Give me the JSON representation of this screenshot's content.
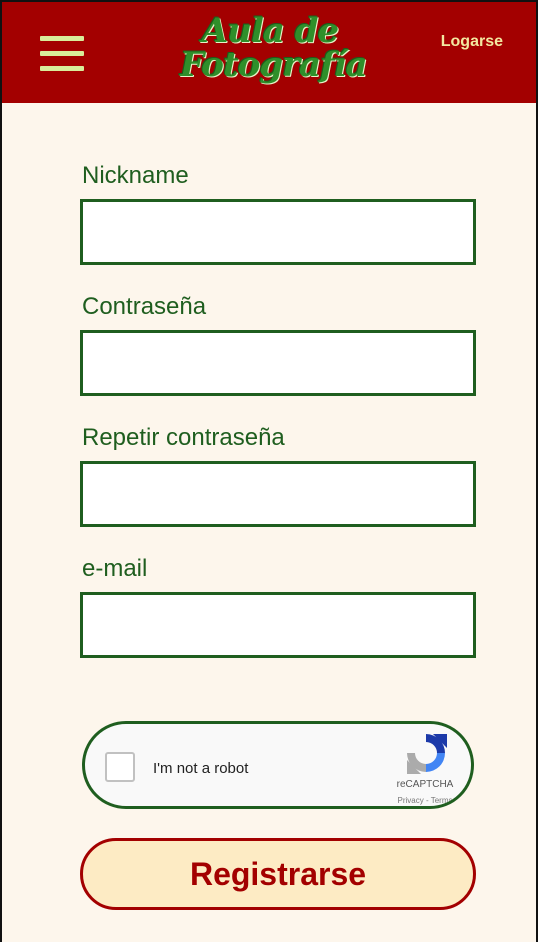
{
  "header": {
    "logo_line1": "Aula de",
    "logo_line2": "Fotografía",
    "login_label": "Logarse"
  },
  "form": {
    "fields": [
      {
        "label": "Nickname",
        "value": "",
        "placeholder": ""
      },
      {
        "label": "Contraseña",
        "value": "",
        "placeholder": ""
      },
      {
        "label": "Repetir contraseña",
        "value": "",
        "placeholder": ""
      },
      {
        "label": "e-mail",
        "value": "",
        "placeholder": ""
      }
    ],
    "captcha": {
      "label": "I'm not a robot",
      "brand": "reCAPTCHA",
      "links": "Privacy - Terms",
      "checked": false
    },
    "submit_label": "Registrarse"
  },
  "colors": {
    "header_bg": "#a30000",
    "page_bg": "#fdf6ec",
    "field_border": "#1f5e1f",
    "button_bg": "#fdebc4",
    "button_text": "#a30000",
    "login_text": "#f3e7a0",
    "menu_icon": "#d9ec9a"
  },
  "icons": [
    "hamburger-menu-icon",
    "recaptcha-logo-icon"
  ]
}
